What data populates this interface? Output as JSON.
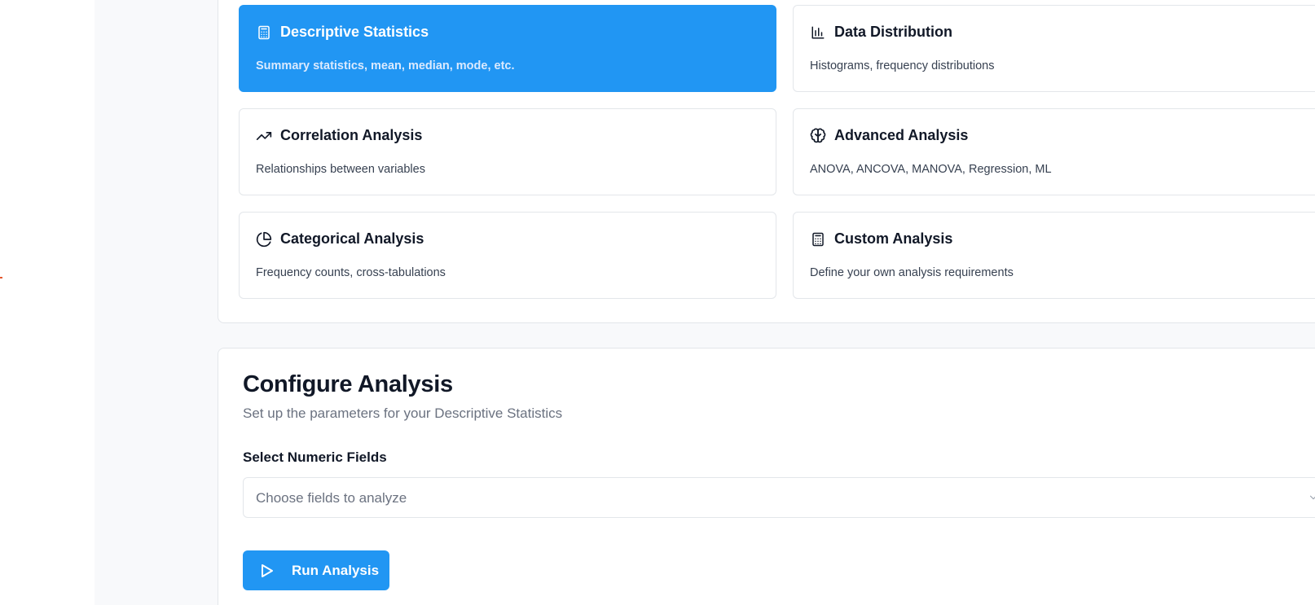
{
  "analysis_types": [
    {
      "title": "Descriptive Statistics",
      "description": "Summary statistics, mean, median, mode, etc.",
      "icon": "calculator-icon",
      "selected": true
    },
    {
      "title": "Data Distribution",
      "description": "Histograms, frequency distributions",
      "icon": "bar-chart-icon",
      "selected": false
    },
    {
      "title": "Correlation Analysis",
      "description": "Relationships between variables",
      "icon": "trending-up-icon",
      "selected": false
    },
    {
      "title": "Advanced Analysis",
      "description": "ANOVA, ANCOVA, MANOVA, Regression, ML",
      "icon": "brain-icon",
      "selected": false
    },
    {
      "title": "Categorical Analysis",
      "description": "Frequency counts, cross-tabulations",
      "icon": "pie-chart-icon",
      "selected": false
    },
    {
      "title": "Custom Analysis",
      "description": "Define your own analysis requirements",
      "icon": "calculator-icon",
      "selected": false
    }
  ],
  "configure": {
    "title": "Configure Analysis",
    "subtitle": "Set up the parameters for your Descriptive Statistics",
    "field_label": "Select Numeric Fields",
    "field_placeholder": "Choose fields to analyze",
    "run_label": "Run Analysis"
  },
  "colors": {
    "accent": "#2196f3",
    "page_background": "#f8f9fb",
    "border": "#e3e6ea"
  }
}
